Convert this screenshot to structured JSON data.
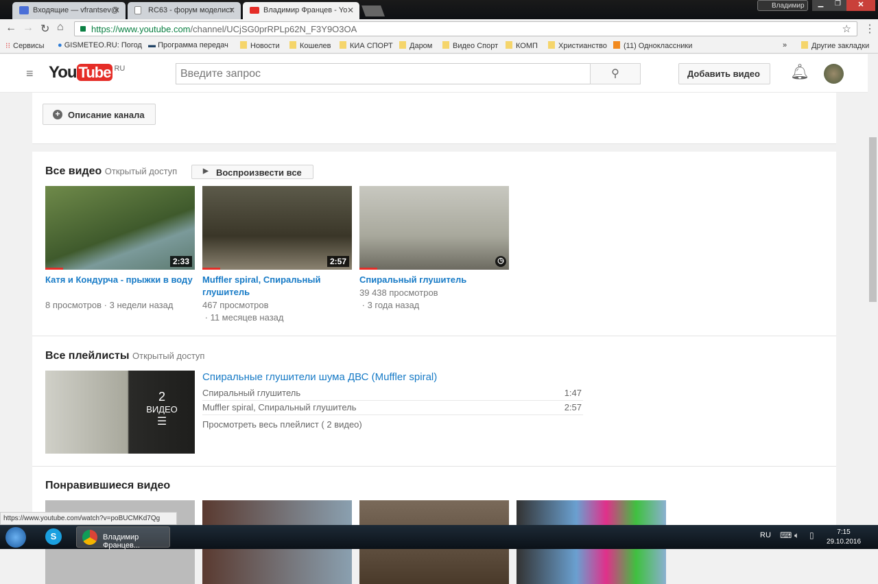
{
  "browser": {
    "tabs": [
      {
        "label": "Входящие — vfrantsev@"
      },
      {
        "label": "RC63 - форум моделист"
      },
      {
        "label": "Владимир Францев - Yo"
      }
    ],
    "profile": "Владимир",
    "url_host": "https://www.youtube.com",
    "url_path": "/channel/UCjSG0prRPLp62N_F3Y9O3OA",
    "bookmarks": [
      "Сервисы",
      "GISMETEO.RU: Погод",
      "Программа передач",
      "Новости",
      "Кошелев",
      "КИА СПОРТ",
      "Даром",
      "Видео Спорт",
      "КОМП",
      "Христианство",
      "(11) Одноклассники"
    ],
    "bookmarks_more": "»",
    "other_bookmarks": "Другие закладки",
    "status_url": "https://www.youtube.com/watch?v=poBUCMKd7Qg"
  },
  "youtube": {
    "logo_you": "You",
    "logo_tube": "Tube",
    "logo_region": "RU",
    "search_placeholder": "Введите запрос",
    "upload_label": "Добавить видео",
    "channel_description_label": "Описание канала",
    "all_videos": {
      "title": "Все видео",
      "access": "Открытый доступ",
      "play_all": "Воспроизвести все",
      "videos": [
        {
          "title": "Катя и Кондурча - прыжки в воду",
          "duration": "2:33",
          "views": "8 просмотров",
          "age": "3 недели назад"
        },
        {
          "title": "Muffler spiral, Спиральный глушитель",
          "duration": "2:57",
          "views": "467 просмотров",
          "age": "11 месяцев назад"
        },
        {
          "title": "Спиральный глушитель",
          "duration": "",
          "views": "39 438 просмотров",
          "age": "3 года назад"
        }
      ]
    },
    "playlists": {
      "title": "Все плейлисты",
      "access": "Открытый доступ",
      "playlist": {
        "count": "2",
        "count_label": "ВИДЕО",
        "title": "Спиральные глушители шума ДВС (Muffler spiral)",
        "items": [
          {
            "title": "Спиральный глушитель",
            "duration": "1:47"
          },
          {
            "title": "Muffler spiral, Спиральный глушитель",
            "duration": "2:57"
          }
        ],
        "view_all": "Просмотреть весь плейлист ( 2 видео)"
      }
    },
    "liked": {
      "title": "Понравившиеся видео"
    }
  },
  "taskbar": {
    "window": "Владимир Францев...",
    "lang": "RU",
    "time": "7:15",
    "date": "29.10.2016"
  },
  "colors": {
    "link": "#167ac6",
    "red": "#e52d27"
  }
}
